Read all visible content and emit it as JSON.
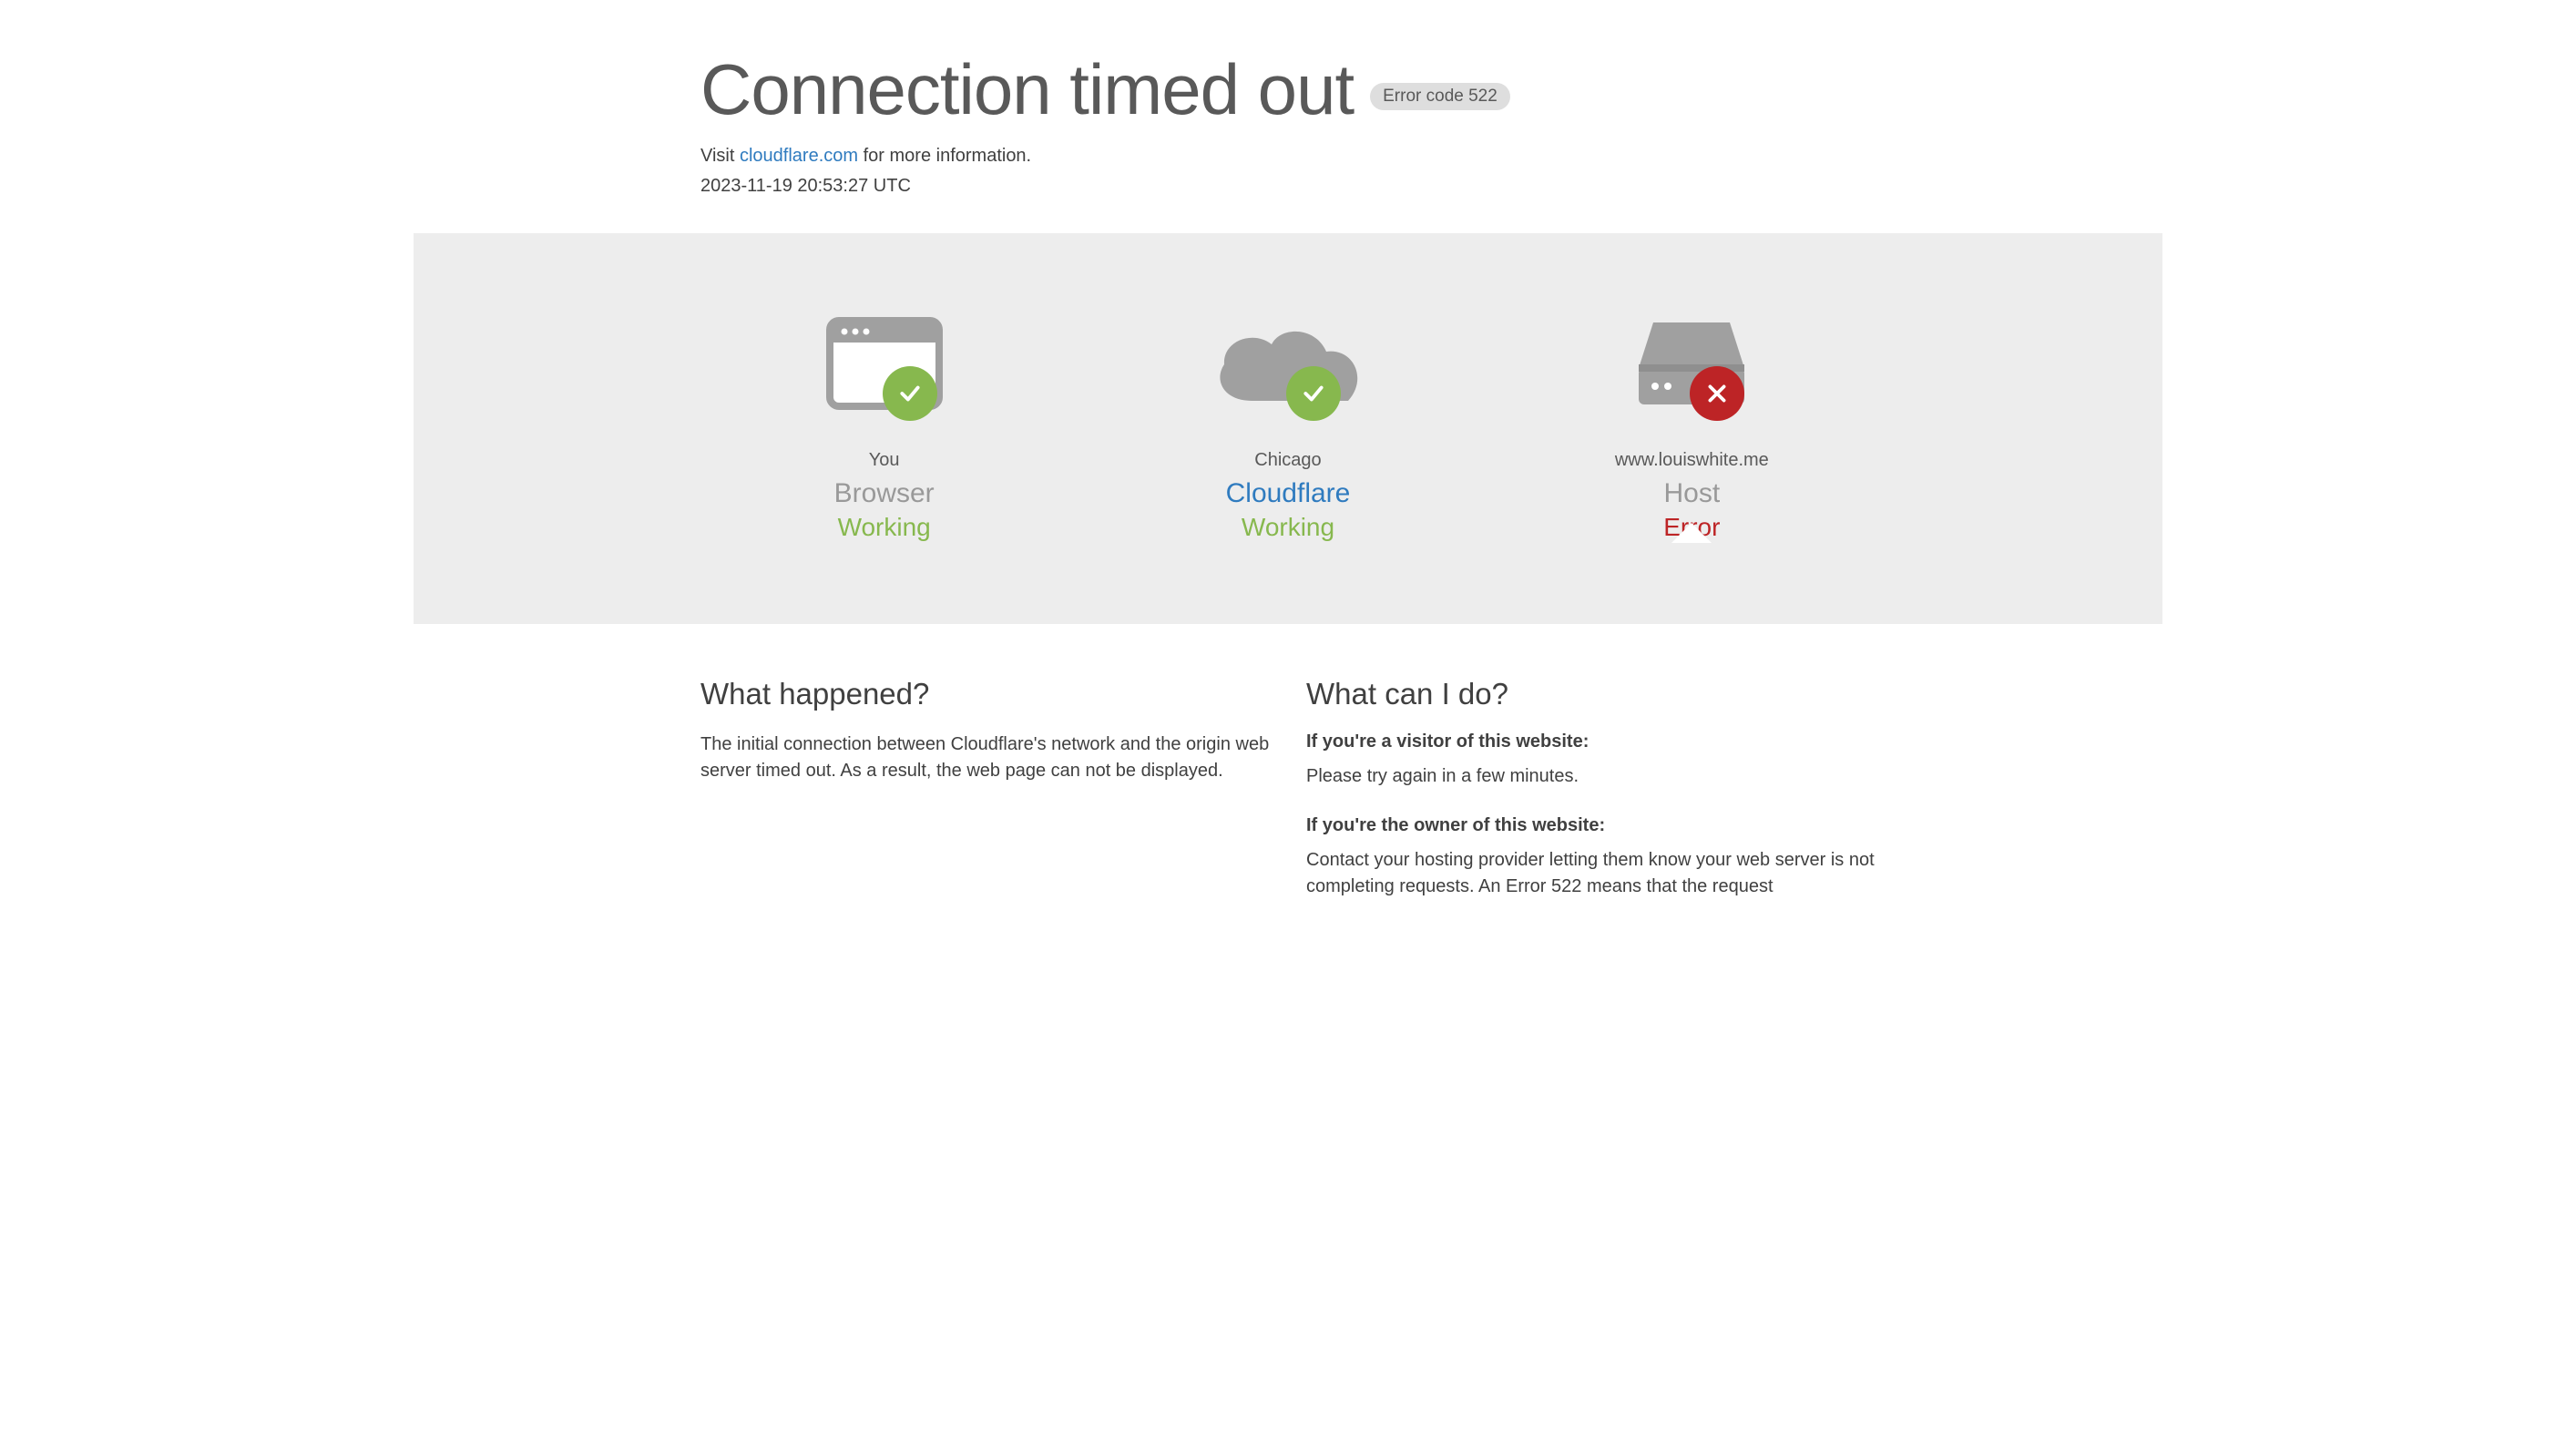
{
  "header": {
    "title": "Connection timed out",
    "error_code": "Error code 522",
    "visit_prefix": "Visit ",
    "visit_link": "cloudflare.com",
    "visit_suffix": " for more information.",
    "timestamp": "2023-11-19 20:53:27 UTC"
  },
  "status": {
    "browser": {
      "subtext": "You",
      "label": "Browser",
      "status": "Working"
    },
    "cloudflare": {
      "subtext": "Chicago",
      "label": "Cloudflare",
      "status": "Working"
    },
    "host": {
      "subtext": "www.louiswhite.me",
      "label": "Host",
      "status": "Error"
    }
  },
  "content": {
    "what_happened": {
      "title": "What happened?",
      "body": "The initial connection between Cloudflare's network and the origin web server timed out. As a result, the web page can not be displayed."
    },
    "what_can_i_do": {
      "title": "What can I do?",
      "visitor_heading": "If you're a visitor of this website:",
      "visitor_body": "Please try again in a few minutes.",
      "owner_heading": "If you're the owner of this website:",
      "owner_body": "Contact your hosting provider letting them know your web server is not completing requests. An Error 522 means that the request"
    }
  }
}
